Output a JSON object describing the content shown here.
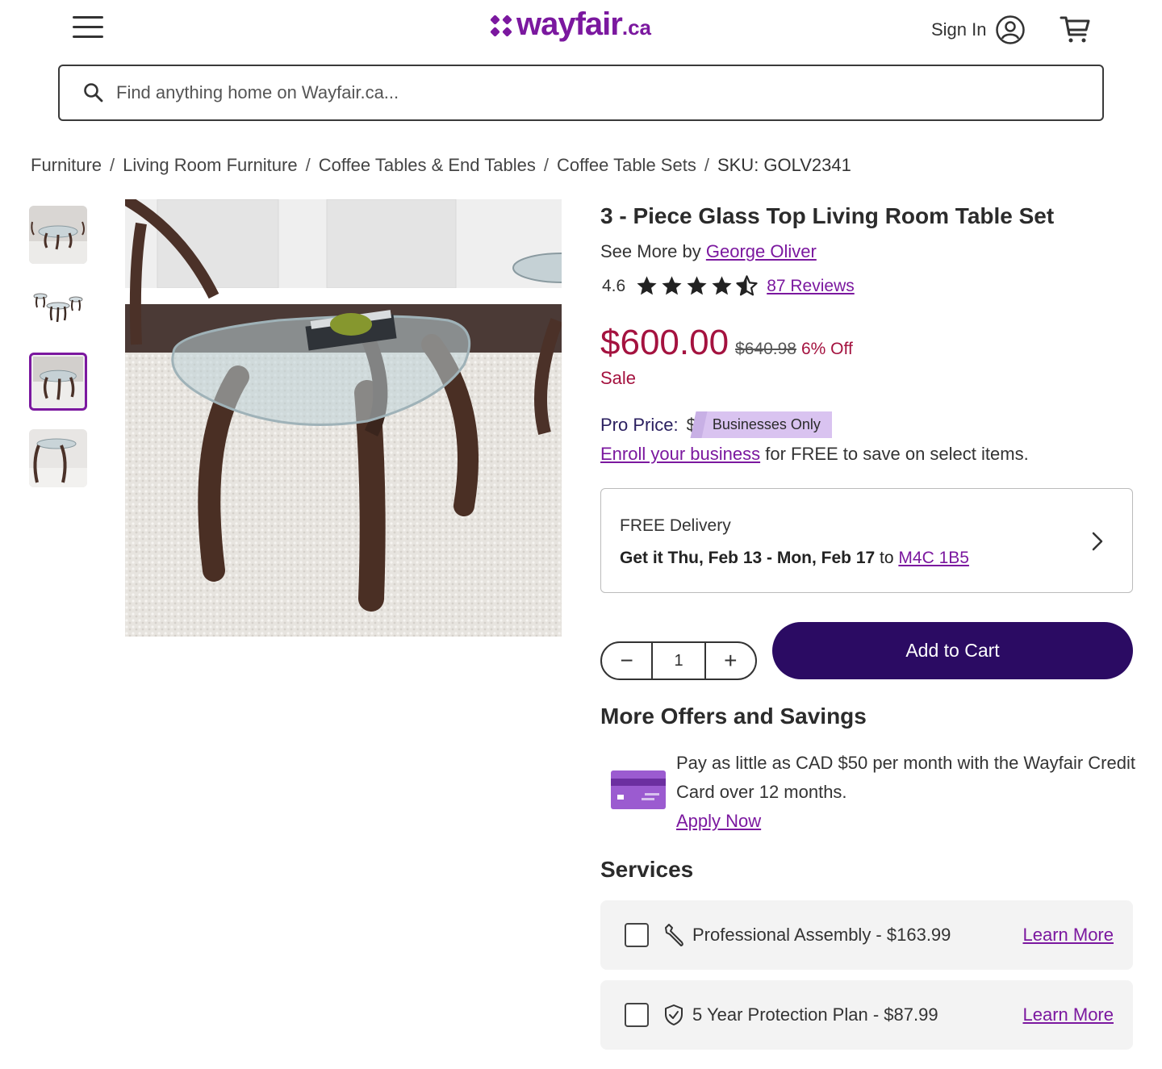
{
  "header": {
    "logo_text": "wayfair",
    "logo_suffix": ".ca",
    "sign_in_label": "Sign In"
  },
  "search": {
    "placeholder": "Find anything home on Wayfair.ca..."
  },
  "breadcrumb": {
    "items": [
      "Furniture",
      "Living Room Furniture",
      "Coffee Tables & End Tables",
      "Coffee Table Sets"
    ],
    "separator": "/",
    "sku": "SKU: GOLV2341"
  },
  "product": {
    "title": "3 - Piece Glass Top Living Room Table Set",
    "by_prefix": "See More by",
    "brand": "George Oliver",
    "rating": "4.6",
    "rating_value": 4.6,
    "reviews_label": "87 Reviews",
    "price": "$600.00",
    "price_old": "$640.98",
    "discount": "6% Off",
    "sale_label": "Sale",
    "pro_price_label": "Pro Price:",
    "pro_price_symbol": "$",
    "pro_badge": "Businesses Only",
    "enroll_link": "Enroll your business",
    "enroll_text": " for FREE to save on select items."
  },
  "delivery": {
    "title": "FREE Delivery",
    "eta": "Get it Thu, Feb 13 - Mon, Feb 17",
    "to": " to ",
    "postal_code": "M4C 1B5"
  },
  "cart": {
    "quantity": "1",
    "minus": "−",
    "plus": "+",
    "add_label": "Add to Cart"
  },
  "offers": {
    "title": "More Offers and Savings",
    "text": "Pay as little as CAD $50 per month with the Wayfair Credit Card over 12 months.",
    "apply_label": "Apply Now"
  },
  "services": {
    "title": "Services",
    "items": [
      {
        "label": "Professional Assembly - $163.99",
        "link": "Learn More",
        "icon": "wrench-icon"
      },
      {
        "label": "5 Year Protection Plan - $87.99",
        "link": "Learn More",
        "icon": "shield-check-icon"
      }
    ]
  },
  "colors": {
    "brand_purple": "#7b189f",
    "price_red": "#a4123f",
    "cart_button": "#2b0b63"
  }
}
